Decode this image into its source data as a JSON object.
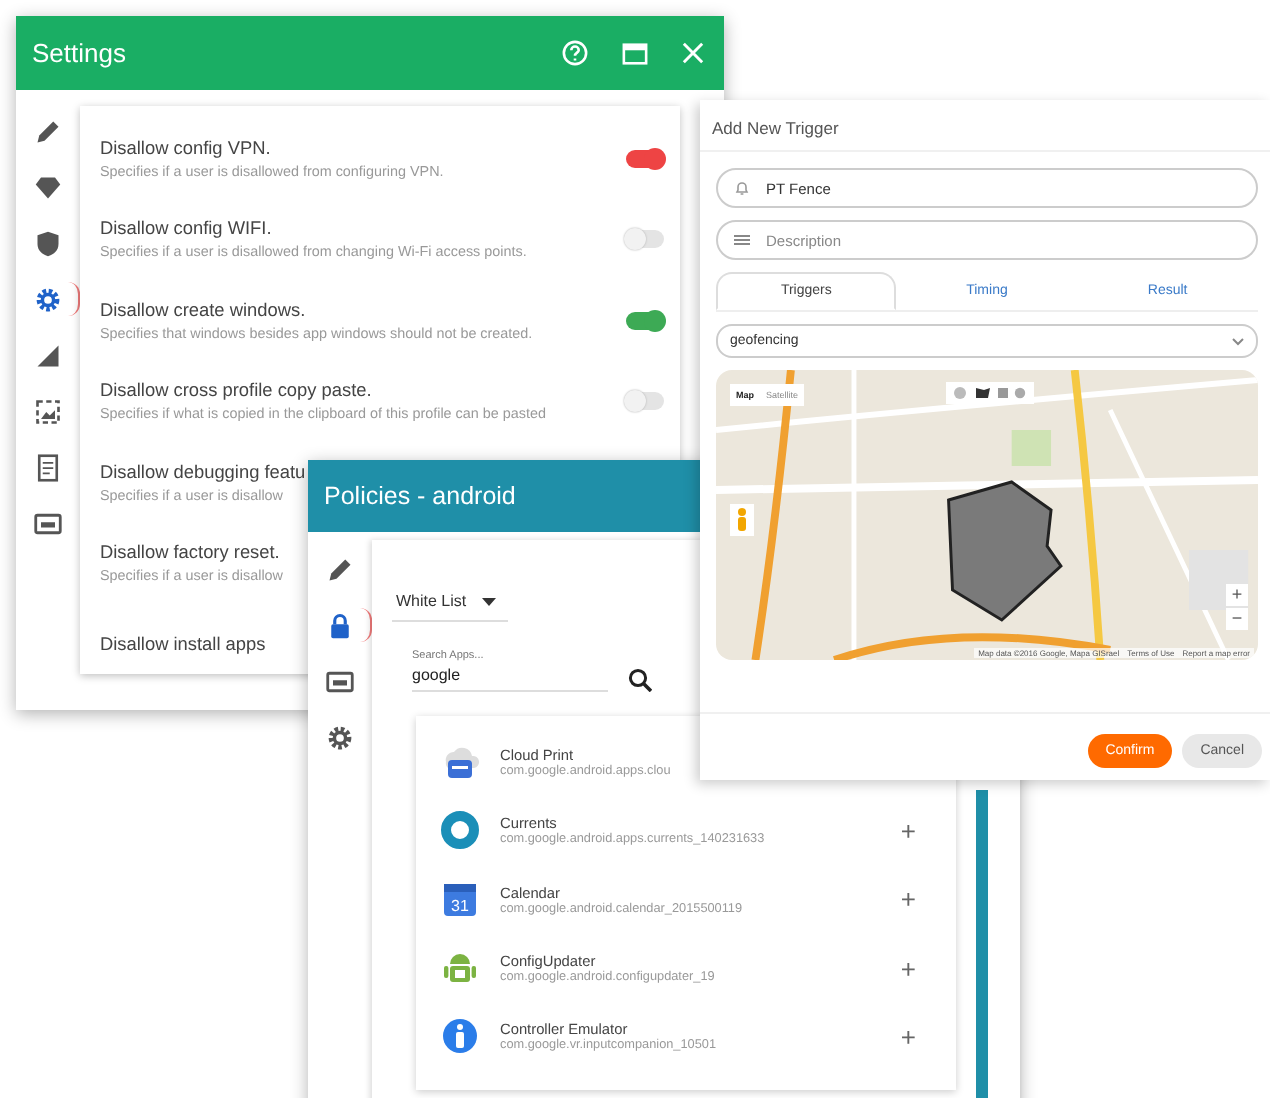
{
  "settings": {
    "title": "Settings",
    "sidebar": [
      {
        "kind": "pencil",
        "selected": false
      },
      {
        "kind": "diamond",
        "selected": false
      },
      {
        "kind": "shield",
        "selected": false
      },
      {
        "kind": "gear",
        "selected": true
      },
      {
        "kind": "signal",
        "selected": false
      },
      {
        "kind": "picture",
        "selected": false
      },
      {
        "kind": "document",
        "selected": false
      },
      {
        "kind": "card",
        "selected": false
      }
    ],
    "rows": [
      {
        "title": "Disallow config VPN.",
        "description": "Specifies if a user is disallowed from configuring VPN.",
        "on": true,
        "color": "#ee4444"
      },
      {
        "title": "Disallow config WIFI.",
        "description": "Specifies if a user is disallowed from changing Wi-Fi access points.",
        "on": false
      },
      {
        "title": "Disallow create windows.",
        "description": "Specifies that windows besides app windows should not be created.",
        "on": true,
        "color": "#3daa55"
      },
      {
        "title": "Disallow cross profile copy paste.",
        "description": "Specifies if what is copied in the clipboard of this profile can be pasted",
        "on": false
      },
      {
        "title": "Disallow debugging featu",
        "description": "Specifies if a user is disallow"
      },
      {
        "title": "Disallow factory reset.",
        "description": "Specifies if a user is disallow"
      },
      {
        "title": "Disallow install apps"
      }
    ]
  },
  "policies": {
    "title": "Policies - android",
    "sidebar": [
      {
        "kind": "pencil",
        "selected": false
      },
      {
        "kind": "lock",
        "selected": true
      },
      {
        "kind": "card",
        "selected": false
      },
      {
        "kind": "gear",
        "selected": false
      }
    ],
    "list_type": "White List",
    "search": {
      "label": "Search Apps...",
      "value": "google"
    },
    "apps": [
      {
        "kind": "cloud",
        "name": "Cloud Print",
        "package": "com.google.android.apps.clou"
      },
      {
        "kind": "ring",
        "name": "Currents",
        "package": "com.google.android.apps.currents_140231633",
        "add": "+"
      },
      {
        "kind": "calendar",
        "icon_label": "31",
        "name": "Calendar",
        "package": "com.google.android.calendar_2015500119",
        "add": "+"
      },
      {
        "kind": "android",
        "name": "ConfigUpdater",
        "package": "com.google.android.configupdater_19",
        "add": "+"
      },
      {
        "kind": "info",
        "name": "Controller Emulator",
        "package": "com.google.vr.inputcompanion_10501",
        "add": "+"
      }
    ]
  },
  "trigger": {
    "title": "Add New Trigger",
    "name": {
      "value": "PT Fence"
    },
    "description": {
      "placeholder": "Description"
    },
    "tabs": [
      {
        "label": "Triggers",
        "selected": true
      },
      {
        "label": "Timing",
        "selected": false
      },
      {
        "label": "Result",
        "selected": false
      }
    ],
    "type_select": {
      "value": "geofencing"
    },
    "map": {
      "types": [
        {
          "label": "Map",
          "selected": true
        },
        {
          "label": "Satellite",
          "selected": false
        }
      ],
      "zoom_in": "+",
      "zoom_out": "−",
      "attribution": "Map data ©2016 Google, Mapa GISrael",
      "terms": "Terms of Use",
      "report": "Report a map error"
    },
    "buttons": [
      {
        "label": "Confirm",
        "kind": "primary"
      },
      {
        "label": "Cancel",
        "kind": "secondary"
      }
    ]
  }
}
